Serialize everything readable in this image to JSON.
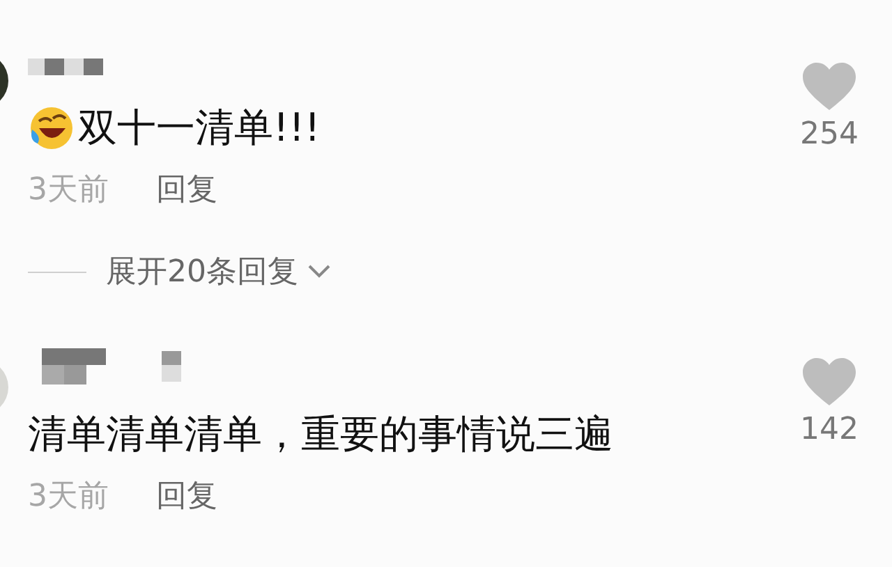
{
  "comments": [
    {
      "kind": "emoji",
      "text": "双十一清单!!!",
      "time": "3天前",
      "reply": "回复",
      "likes": "254",
      "expand": "展开20条回复"
    },
    {
      "kind": "plain",
      "text": "清单清单清单，重要的事情说三遍",
      "time": "3天前",
      "reply": "回复",
      "likes": "142"
    }
  ]
}
